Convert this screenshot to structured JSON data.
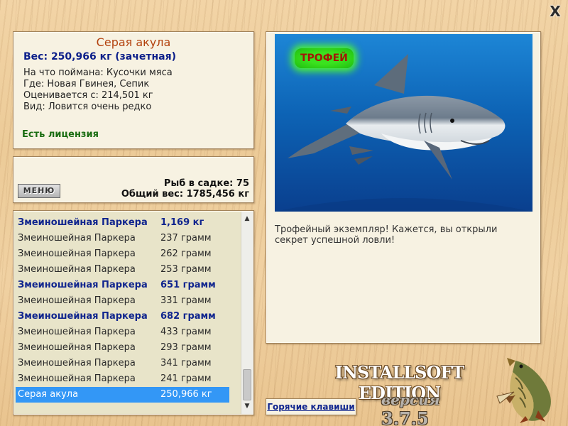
{
  "window": {
    "close_label": "X"
  },
  "info": {
    "fish_name": "Серая акула",
    "weight_line": "Вес: 250,966 кг (зачетная)",
    "lines": [
      "На что поймана: Кусочки мяса",
      "Где: Новая Гвинея, Сепик",
      "Оценивается с: 214,501 кг",
      "Вид: Ловится очень редко"
    ],
    "license": "Есть лицензия"
  },
  "stats": {
    "menu_label": "МЕНЮ",
    "fish_in_keepnet": "Рыб в садке: 75",
    "total_weight": "Общий вес: 1785,456 кг"
  },
  "catch_list": [
    {
      "name": "Змеиношейная Паркера",
      "weight": "1,169 кг",
      "state": "trophy"
    },
    {
      "name": "Змеиношейная Паркера",
      "weight": "237 грамм",
      "state": "normal"
    },
    {
      "name": "Змеиношейная Паркера",
      "weight": "262 грамм",
      "state": "normal"
    },
    {
      "name": "Змеиношейная Паркера",
      "weight": "253 грамм",
      "state": "normal"
    },
    {
      "name": "Змеиношейная Паркера",
      "weight": "651 грамм",
      "state": "trophy"
    },
    {
      "name": "Змеиношейная Паркера",
      "weight": "331 грамм",
      "state": "normal"
    },
    {
      "name": "Змеиношейная Паркера",
      "weight": "682 грамм",
      "state": "trophy"
    },
    {
      "name": "Змеиношейная Паркера",
      "weight": "433 грамм",
      "state": "normal"
    },
    {
      "name": "Змеиношейная Паркера",
      "weight": "293 грамм",
      "state": "normal"
    },
    {
      "name": "Змеиношейная Паркера",
      "weight": "341 грамм",
      "state": "normal"
    },
    {
      "name": "Змеиношейная Паркера",
      "weight": "241 грамм",
      "state": "normal"
    },
    {
      "name": "Серая акула",
      "weight": "250,966 кг",
      "state": "selected"
    }
  ],
  "scrollbar": {
    "up_icon": "chevron-up-icon",
    "down_icon": "chevron-down-icon"
  },
  "trophy": {
    "badge": "ТРОФЕЙ",
    "message": "Трофейный экземпляр! Кажется, вы открыли секрет успешной ловли!"
  },
  "hotkeys_label": "Горячие клавиши",
  "branding": {
    "title": "INSTALLSOFT EDITION",
    "version_word": "версия",
    "version_number": "3.7.5"
  },
  "colors": {
    "trophy_text": "#10258e",
    "name_title": "#b3420e",
    "license": "#1a6d12",
    "selection": "#3397f6",
    "water": "#0d63b5"
  }
}
